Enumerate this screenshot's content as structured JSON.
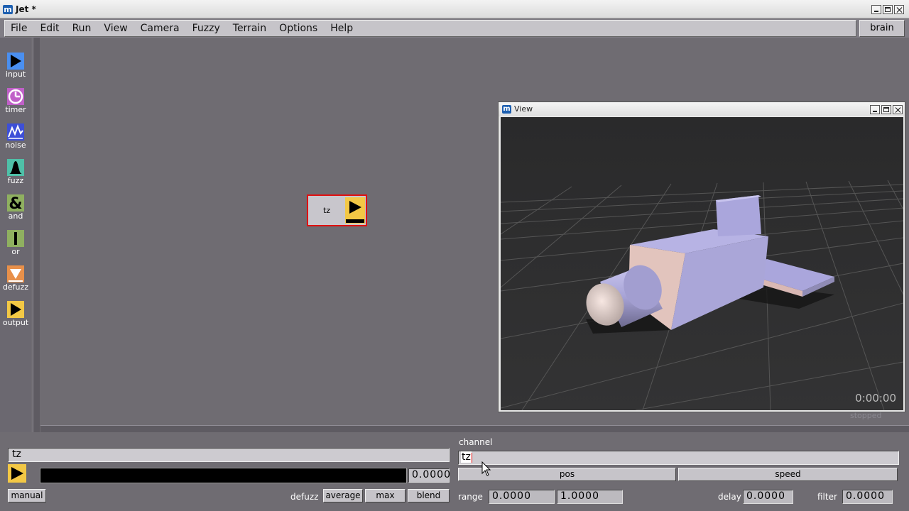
{
  "window": {
    "title": "Jet *"
  },
  "menu": {
    "items": [
      "File",
      "Edit",
      "Run",
      "View",
      "Camera",
      "Fuzzy",
      "Terrain",
      "Options",
      "Help"
    ],
    "brain_button": "brain"
  },
  "toolbox": [
    {
      "label": "input",
      "icon": "input-arrow-icon",
      "color": "#4a8ff0"
    },
    {
      "label": "timer",
      "icon": "timer-clock-icon",
      "color": "#c060c8"
    },
    {
      "label": "noise",
      "icon": "noise-wave-icon",
      "color": "#3d4fd8"
    },
    {
      "label": "fuzz",
      "icon": "fuzz-bell-icon",
      "color": "#4fc0a8"
    },
    {
      "label": "and",
      "icon": "and-ampersand-icon",
      "color": "#8fb060"
    },
    {
      "label": "or",
      "icon": "or-bar-icon",
      "color": "#8fb060"
    },
    {
      "label": "defuzz",
      "icon": "defuzz-triangle-icon",
      "color": "#e8904a"
    },
    {
      "label": "output",
      "icon": "output-arrow-icon",
      "color": "#f3c845"
    }
  ],
  "node": {
    "label": "tz",
    "type": "output"
  },
  "view_window": {
    "title": "View",
    "clock": "0:00:00",
    "status": "stopped"
  },
  "bottom": {
    "name_value": "tz",
    "output_value": "0.0000",
    "manual_button": "manual",
    "defuzz_label": "defuzz",
    "defuzz_options": [
      "average",
      "max",
      "blend"
    ],
    "channel_label": "channel",
    "channel_value": "tz",
    "pos_button": "pos",
    "speed_button": "speed",
    "range_label": "range",
    "range_min": "0.0000",
    "range_max": "1.0000",
    "delay_label": "delay",
    "delay_value": "0.0000",
    "filter_label": "filter",
    "filter_value": "0.0000"
  }
}
